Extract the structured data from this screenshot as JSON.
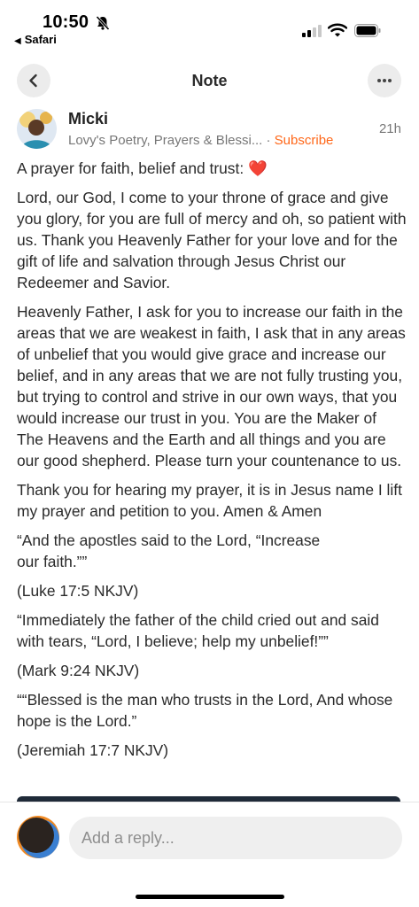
{
  "status_bar": {
    "time": "10:50",
    "back_app": "Safari"
  },
  "header": {
    "title": "Note"
  },
  "author": {
    "name": "Micki",
    "publication": "Lovy's Poetry, Prayers & Blessi...",
    "separator": "·",
    "subscribe_label": "Subscribe",
    "timestamp": "21h"
  },
  "note": {
    "paragraphs": [
      "A prayer for faith, belief and trust: ❤️",
      "Lord, our God, I come to your throne of grace and give you glory, for you are full of mercy and oh, so patient with us. Thank you Heavenly Father for your love and for the gift of life and salvation through Jesus Christ our Redeemer and Savior.",
      "Heavenly Father, I ask for you to increase our faith in the areas that we are weakest in faith, I ask that in any areas of unbelief that you would give grace and increase our belief, and in any areas that we are not fully trusting you, but trying to control and strive in our own ways, that you would increase our trust in you. You are the Maker of The Heavens and the Earth and all things and you are our good shepherd. Please turn your countenance to us.",
      "Thank you for hearing my prayer, it is in Jesus name I lift my prayer and petition to you. Amen & Amen",
      "“And the apostles said to the Lord, “Increase our faith.””",
      "(Luke 17:5 NKJV)",
      "“Immediately the father of the child cried out and said with tears, “Lord, I believe; help my unbelief!””",
      "(Mark 9:24 NKJV)",
      "““Blessed is the man who trusts in the Lord, And whose hope is the Lord.”",
      "(Jeremiah 17:7 NKJV)"
    ]
  },
  "reply": {
    "placeholder": "Add a reply..."
  },
  "colors": {
    "accent": "#ff6719",
    "button_bg": "#ececec",
    "input_bg": "#efefef"
  },
  "icons": {
    "back": "chevron-left-icon",
    "more": "ellipsis-icon",
    "bell": "bell-slash-icon"
  }
}
